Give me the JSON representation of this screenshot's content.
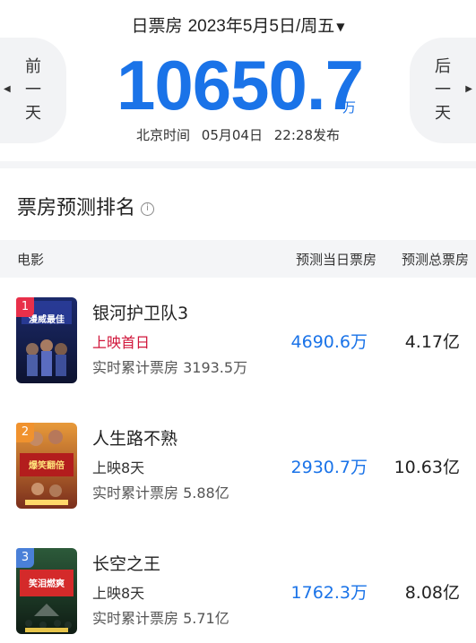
{
  "header": {
    "date_label": "日票房",
    "date_value": "2023年5月5日/周五",
    "prev_chars": [
      "前",
      "一",
      "天"
    ],
    "next_chars": [
      "后",
      "一",
      "天"
    ],
    "box_office": "10650.7",
    "unit": "万",
    "publish_prefix": "北京时间",
    "publish_date": "05月04日",
    "publish_time": "22:28发布"
  },
  "section": {
    "title": "票房预测排名"
  },
  "columns": {
    "movie": "电影",
    "today": "预测当日票房",
    "total": "预测总票房"
  },
  "movies": [
    {
      "rank": "1",
      "title": "银河护卫队3",
      "status": "上映首日",
      "cumulative": "实时累计票房 3193.5万",
      "today": "4690.6万",
      "total": "4.17亿",
      "badge_color": "#e8304a",
      "poster_text": "漫威最佳"
    },
    {
      "rank": "2",
      "title": "人生路不熟",
      "status": "上映8天",
      "cumulative": "实时累计票房 5.88亿",
      "today": "2930.7万",
      "total": "10.63亿",
      "badge_color": "#f0922e",
      "poster_text": "爆笑翻倍"
    },
    {
      "rank": "3",
      "title": "长空之王",
      "status": "上映8天",
      "cumulative": "实时累计票房 5.71亿",
      "today": "1762.3万",
      "total": "8.08亿",
      "badge_color": "#4a80d8",
      "poster_text": "笑泪燃爽"
    }
  ]
}
